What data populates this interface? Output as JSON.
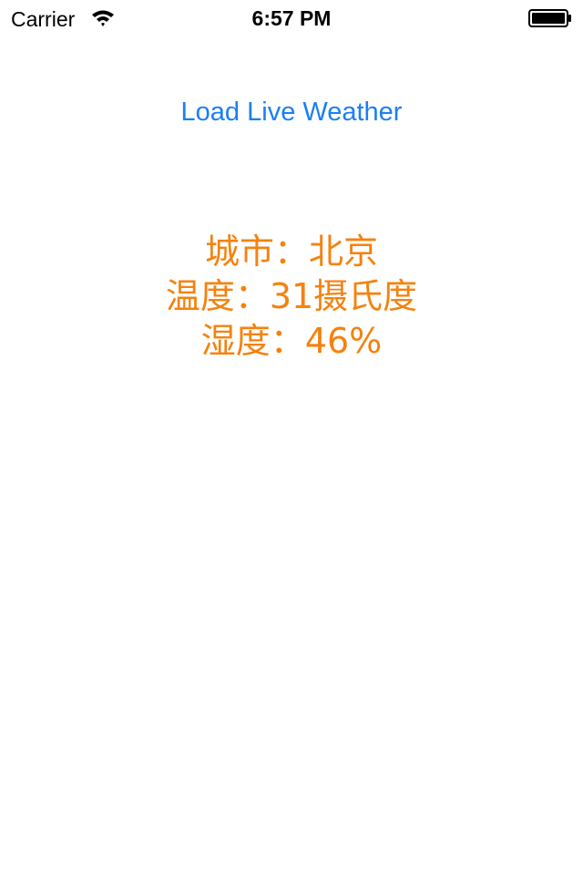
{
  "status_bar": {
    "carrier": "Carrier",
    "time": "6:57 PM",
    "wifi_icon": "wifi-icon",
    "battery_icon": "battery-full-icon",
    "battery_level": 1.0
  },
  "main": {
    "load_button_label": "Load Live Weather",
    "city_line": "城市：北京",
    "temperature_line": "温度：31摄氏度",
    "humidity_line": "湿度：46%"
  },
  "colors": {
    "accent_blue": "#1a7ff3",
    "weather_orange": "#f5820e",
    "background": "#ffffff",
    "status_text": "#000000"
  }
}
